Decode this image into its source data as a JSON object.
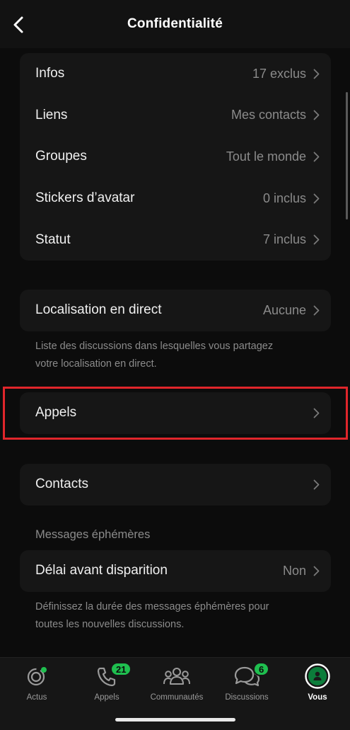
{
  "header": {
    "title": "Confidentialité"
  },
  "group1": {
    "rows": [
      {
        "label": "Infos",
        "value": "17 exclus"
      },
      {
        "label": "Liens",
        "value": "Mes contacts"
      },
      {
        "label": "Groupes",
        "value": "Tout le monde"
      },
      {
        "label": "Stickers d’avatar",
        "value": "0 inclus"
      },
      {
        "label": "Statut",
        "value": "7 inclus"
      }
    ]
  },
  "live_location": {
    "label": "Localisation en direct",
    "value": "Aucune",
    "note_line1": "Liste des discussions dans lesquelles vous partagez",
    "note_line2": "votre localisation en direct."
  },
  "calls": {
    "label": "Appels"
  },
  "contacts": {
    "label": "Contacts"
  },
  "ephemeral": {
    "section_title": "Messages éphémères",
    "label": "Délai avant disparition",
    "value": "Non",
    "note_line1": "Définissez la durée des messages éphémères pour",
    "note_line2": "toutes les nouvelles discussions."
  },
  "tabbar": {
    "tabs": [
      {
        "label": "Actus",
        "icon": "updates-icon"
      },
      {
        "label": "Appels",
        "icon": "phone-icon",
        "badge": "21"
      },
      {
        "label": "Communautés",
        "icon": "communities-icon"
      },
      {
        "label": "Discussions",
        "icon": "chats-icon",
        "badge": "6"
      },
      {
        "label": "Vous",
        "icon": "profile-icon",
        "active": true
      }
    ]
  },
  "colors": {
    "highlight": "#e0262b",
    "accent": "#1fbf4f"
  }
}
